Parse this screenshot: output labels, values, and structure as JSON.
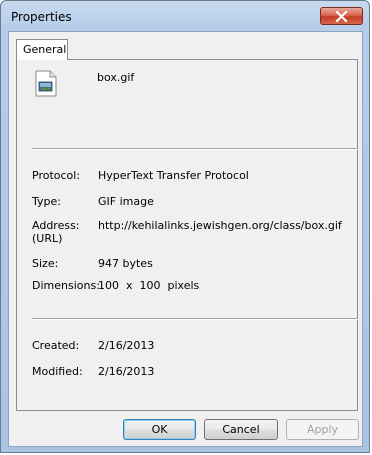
{
  "window": {
    "title": "Properties",
    "close_label": "close"
  },
  "tabs": [
    {
      "label": "General",
      "selected": true
    }
  ],
  "file": {
    "icon": "gif-image-icon",
    "name": "box.gif"
  },
  "properties": {
    "protocol_label": "Protocol:",
    "protocol_value": "HyperText Transfer Protocol",
    "type_label": "Type:",
    "type_value": "GIF image",
    "address_label": "Address:",
    "address_label_2": "(URL)",
    "address_value": "http://kehilalinks.jewishgen.org/class/box.gif",
    "size_label": "Size:",
    "size_value": "947 bytes",
    "dimensions_label": "Dimensions:",
    "dimensions_value": "100  x  100  pixels",
    "created_label": "Created:",
    "created_value": "2/16/2013",
    "modified_label": "Modified:",
    "modified_value": "2/16/2013"
  },
  "buttons": {
    "ok": "OK",
    "cancel": "Cancel",
    "apply": "Apply"
  },
  "colors": {
    "titlebar": "#b6cde9",
    "close_button": "#c13c24",
    "panel_bg": "#f0f0f0",
    "default_button_border": "#3c7fb1"
  }
}
